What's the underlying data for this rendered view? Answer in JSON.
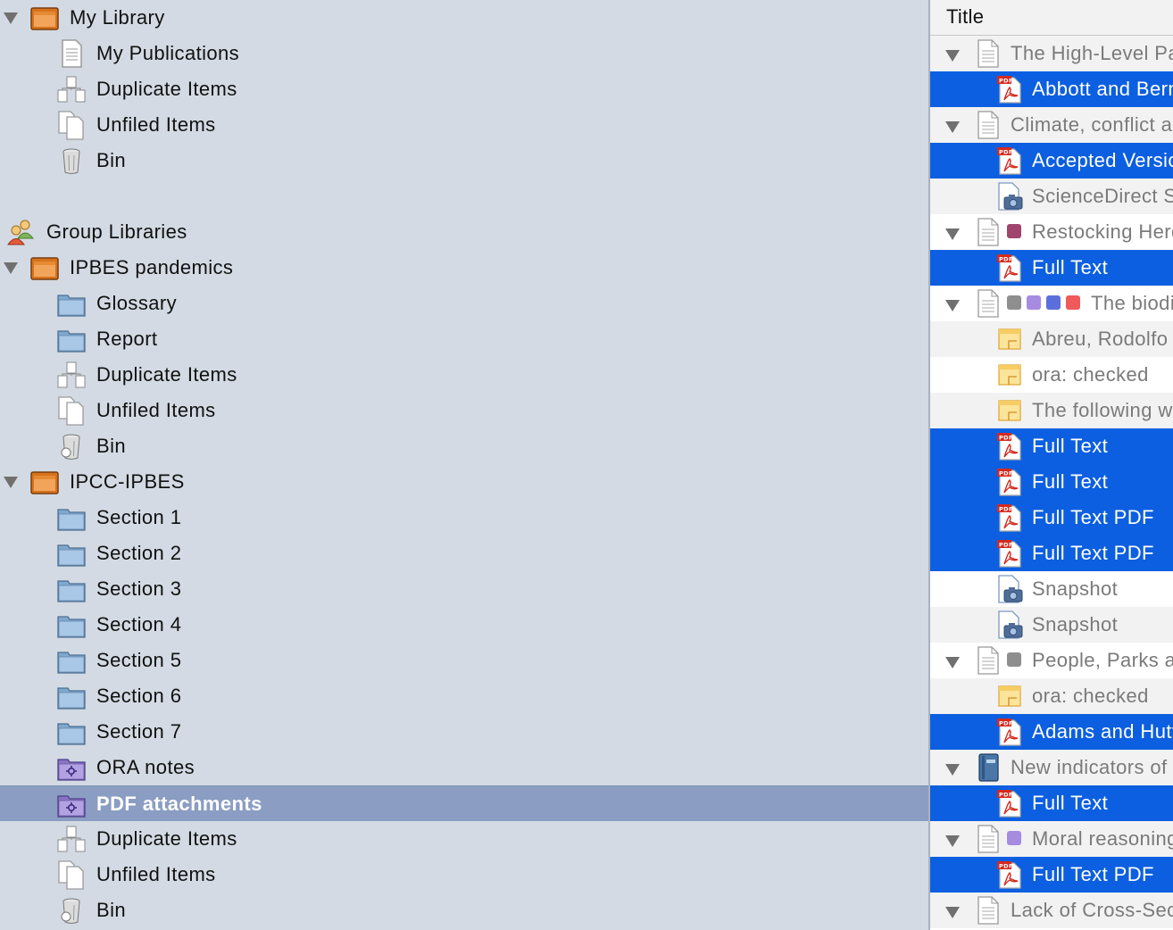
{
  "collections": [
    {
      "label": "My Library",
      "type": "library",
      "twisty": true
    },
    {
      "label": "My Publications",
      "type": "publications"
    },
    {
      "label": "Duplicate Items",
      "type": "duplicates"
    },
    {
      "label": "Unfiled Items",
      "type": "unfiled"
    },
    {
      "label": "Bin",
      "type": "bin"
    },
    {
      "label": "",
      "type": "spacer"
    },
    {
      "label": "Group Libraries",
      "type": "groups"
    },
    {
      "label": "IPBES pandemics",
      "type": "library",
      "twisty": true
    },
    {
      "label": "Glossary",
      "type": "folder"
    },
    {
      "label": "Report",
      "type": "folder"
    },
    {
      "label": "Duplicate Items",
      "type": "duplicates"
    },
    {
      "label": "Unfiled Items",
      "type": "unfiled"
    },
    {
      "label": "Bin",
      "type": "bin-full"
    },
    {
      "label": "IPCC-IPBES",
      "type": "library",
      "twisty": true
    },
    {
      "label": "Section 1",
      "type": "folder"
    },
    {
      "label": "Section 2",
      "type": "folder"
    },
    {
      "label": "Section 3",
      "type": "folder"
    },
    {
      "label": "Section 4",
      "type": "folder"
    },
    {
      "label": "Section 5",
      "type": "folder"
    },
    {
      "label": "Section 6",
      "type": "folder"
    },
    {
      "label": "Section 7",
      "type": "folder"
    },
    {
      "label": "ORA notes",
      "type": "saved-search"
    },
    {
      "label": "PDF attachments",
      "type": "saved-search",
      "selected": true
    },
    {
      "label": "Duplicate Items",
      "type": "duplicates"
    },
    {
      "label": "Unfiled Items",
      "type": "unfiled"
    },
    {
      "label": "Bin",
      "type": "bin-full"
    }
  ],
  "items_header": {
    "title": "Title"
  },
  "items": [
    {
      "label": "The High-Level Panel",
      "type": "document",
      "parent": true
    },
    {
      "label": "Abbott and Bernstein",
      "type": "pdf",
      "selected": true
    },
    {
      "label": "Climate, conflict and",
      "type": "document",
      "parent": true
    },
    {
      "label": "Accepted Version",
      "type": "pdf",
      "selected": true
    },
    {
      "label": "ScienceDirect Snapshot",
      "type": "snapshot"
    },
    {
      "label": "Restocking Herds",
      "type": "document",
      "parent": true,
      "tags": [
        "#a0446e"
      ]
    },
    {
      "label": "Full Text",
      "type": "pdf",
      "selected": true
    },
    {
      "label": "The biodiversity",
      "type": "document",
      "parent": true,
      "tags": [
        "#8e8e8e",
        "#a68be0",
        "#5b6fdc",
        "#f05a5a"
      ]
    },
    {
      "label": "Abreu, Rodolfo",
      "type": "note"
    },
    {
      "label": "ora: checked",
      "type": "note"
    },
    {
      "label": "The following was",
      "type": "note"
    },
    {
      "label": "Full Text",
      "type": "pdf",
      "selected": true
    },
    {
      "label": "Full Text",
      "type": "pdf",
      "selected": true
    },
    {
      "label": "Full Text PDF",
      "type": "pdf",
      "selected": true
    },
    {
      "label": "Full Text PDF",
      "type": "pdf",
      "selected": true
    },
    {
      "label": "Snapshot",
      "type": "snapshot"
    },
    {
      "label": "Snapshot",
      "type": "snapshot"
    },
    {
      "label": "People, Parks and",
      "type": "document",
      "parent": true,
      "tags": [
        "#8e8e8e"
      ]
    },
    {
      "label": "ora: checked",
      "type": "note"
    },
    {
      "label": "Adams and Hutton",
      "type": "pdf",
      "selected": true
    },
    {
      "label": "New indicators of",
      "type": "book",
      "parent": true
    },
    {
      "label": "Full Text",
      "type": "pdf",
      "selected": true
    },
    {
      "label": "Moral reasoning",
      "type": "document",
      "parent": true,
      "tags": [
        "#a68be0"
      ]
    },
    {
      "label": "Full Text PDF",
      "type": "pdf",
      "selected": true
    },
    {
      "label": "Lack of Cross-Sectoral",
      "type": "document",
      "parent": true
    }
  ]
}
